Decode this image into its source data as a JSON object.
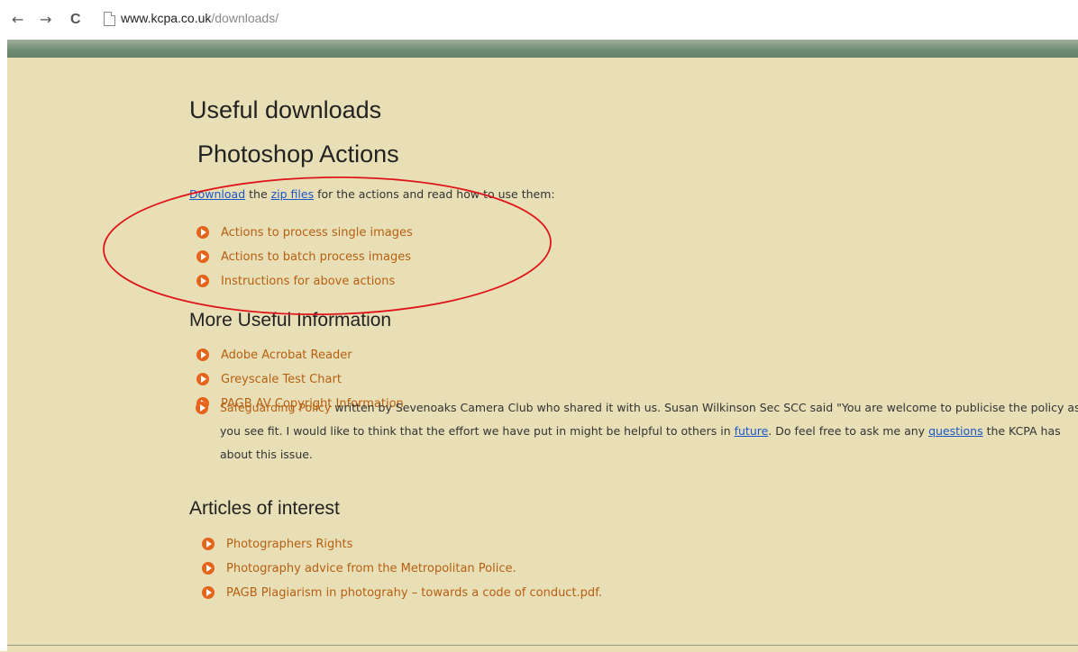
{
  "browser": {
    "back_glyph": "←",
    "forward_glyph": "→",
    "reload_glyph": "C",
    "url_host": "www.kcpa.co.uk",
    "url_path": "/downloads/"
  },
  "page": {
    "title": "Useful downloads",
    "actions_heading": "Photoshop Actions",
    "intro": {
      "download_link": "Download",
      "text1": " the ",
      "zip_link": "zip files",
      "text2": " for the actions and read how to use them:"
    },
    "actions_items": [
      "Actions to process single images",
      "Actions  to batch process images",
      "Instructions for above actions"
    ],
    "more_heading": "More Useful Information",
    "more_items": [
      "Adobe Acrobat Reader",
      "Greyscale Test Chart",
      "PAGB AV Copyright Information"
    ],
    "safeguarding": {
      "link": "Safeguarding Policy",
      "text1": " written by Sevenoaks Camera Club who shared it with us. Susan Wilkinson Sec SCC said \"You are welcome to publicise the policy as you see fit.  I would like to think that the effort we have put in might be helpful to others in ",
      "future_link": "future",
      "text2": ".  Do feel free to ask me any ",
      "questions_link": "questions",
      "text3": " the KCPA has about this issue."
    },
    "articles_heading": "Articles of interest",
    "articles_items": [
      "Photographers Rights",
      "Photography advice from the Metropolitan Police.",
      "PAGB Plagiarism in photograhy – towards a code of conduct.pdf."
    ]
  },
  "colors": {
    "background": "#e8dfb6",
    "link_orange": "#b65f12",
    "link_blue": "#1b56c9",
    "bullet": "#e5641c",
    "annotation_oval": "#e0151b"
  }
}
